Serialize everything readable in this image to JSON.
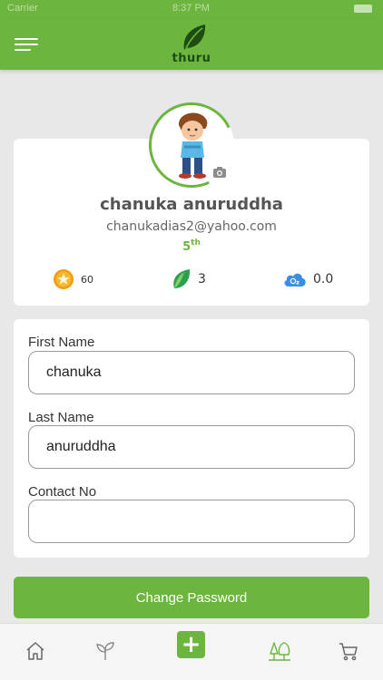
{
  "status_bar": {
    "carrier": "Carrier",
    "time": "8:37 PM"
  },
  "header": {
    "logo_text": "thuru",
    "menu_icon": "hamburger-menu-icon"
  },
  "profile": {
    "name": "chanuka anuruddha",
    "email": "chanukadias2@yahoo.com",
    "rank_number": "5",
    "rank_suffix": "th",
    "stats": {
      "points": "60",
      "trees": "3",
      "oxygen": "0.0"
    }
  },
  "form": {
    "first_name_label": "First Name",
    "first_name_value": "chanuka",
    "last_name_label": "Last Name",
    "last_name_value": "anuruddha",
    "contact_label": "Contact No",
    "contact_value": ""
  },
  "actions": {
    "change_password": "Change Password"
  },
  "bottom_nav": {
    "items": [
      "home-icon",
      "sprout-icon",
      "add-icon",
      "trees-icon",
      "cart-icon"
    ],
    "active": "trees-icon"
  },
  "colors": {
    "brand": "#6cb63f",
    "background": "#e8e8e8",
    "card": "#ffffff",
    "logo_text": "#1e4d12"
  }
}
